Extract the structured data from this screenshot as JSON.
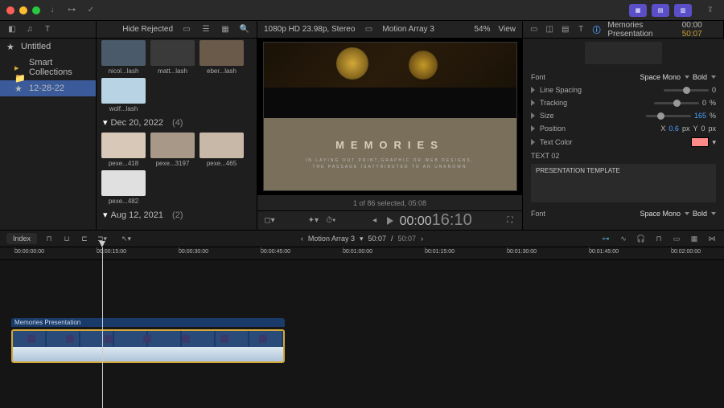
{
  "window": {
    "traffic": [
      "close",
      "minimize",
      "zoom"
    ]
  },
  "sysbar": {
    "icons": [
      "arrow-down",
      "key",
      "checkmark-circle"
    ]
  },
  "toolbar": {
    "hide_rejected": "Hide Rejected",
    "format": "1080p HD 23.98p, Stereo",
    "project": "Motion Array 3",
    "zoom": "54%",
    "view": "View"
  },
  "library": {
    "untitled": "Untitled",
    "smart": "Smart Collections",
    "event": "12-28-22"
  },
  "browser": {
    "row1": [
      "nicol...lash",
      "matt...lash",
      "eber...lash"
    ],
    "row2": [
      "wolf...lash"
    ],
    "date1": "Dec 20, 2022",
    "count1": "(4)",
    "row3": [
      "pexe...418",
      "pexe...3197",
      "pexe...465"
    ],
    "row4": [
      "pexe...482"
    ],
    "date2": "Aug 12, 2021",
    "count2": "(2)",
    "status": "1 of 86 selected, 05:08"
  },
  "viewer": {
    "title": "MEMORIES",
    "body1": "IN LAYING OUT PRINT,GRAPHIC OR WEB DESIGNS,",
    "body2": "THE PASSAGE ISATTRIBUTED TO AN UNKNOWN",
    "tc_prefix": "00:00",
    "tc_frames": "16:10"
  },
  "inspector": {
    "title": "Memories Presentation",
    "tc": "00:00",
    "total": "50:07",
    "font_label": "Font",
    "font_val": "Space Mono",
    "weight": "Bold",
    "line_label": "Line Spacing",
    "line_val": "0",
    "track_label": "Tracking",
    "track_val": "0",
    "track_unit": "%",
    "size_label": "Size",
    "size_val": "165",
    "size_unit": "%",
    "pos_label": "Position",
    "pos_x": "X",
    "pos_xv": "0.6",
    "pos_xu": "px",
    "pos_y": "Y",
    "pos_yv": "0",
    "pos_yu": "px",
    "tcolor_label": "Text Color",
    "text02": "TEXT 02",
    "textarea": "PRESENTATION\nTEMPLATE",
    "font2_label": "Font",
    "font2_val": "Space Mono",
    "weight2": "Bold"
  },
  "tlheader": {
    "index": "Index",
    "project": "Motion Array 3",
    "cur": "50:07",
    "tot": "50:07"
  },
  "ruler": [
    "00:00:00:00",
    "00:00:15:00",
    "00:00:30:00",
    "00:00:45:00",
    "00:01:00:00",
    "00:01:15:00",
    "00:01:30:00",
    "00:01:45:00",
    "00:02:00:00"
  ],
  "clip": {
    "name": "Memories Presentation"
  }
}
